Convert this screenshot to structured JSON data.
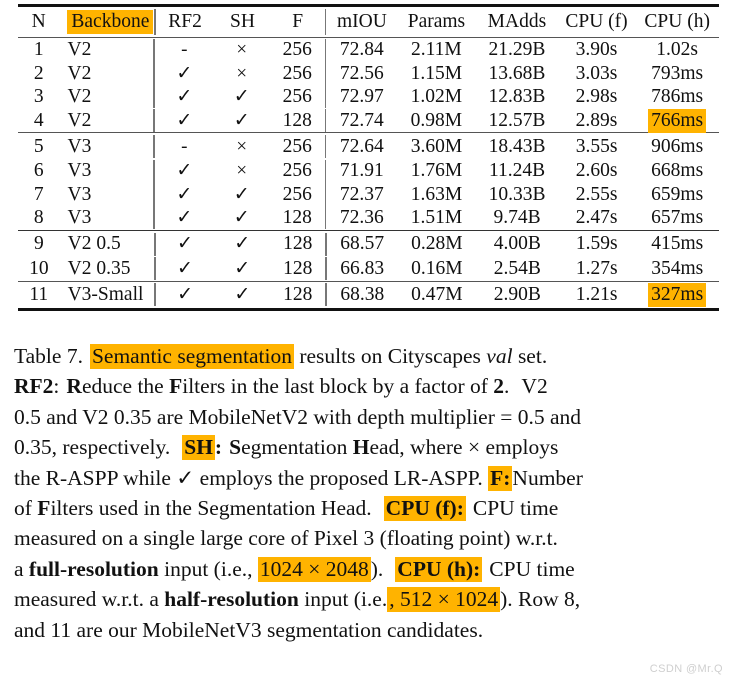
{
  "highlight_color": "#FFB300",
  "table": {
    "columns": [
      "N",
      "Backbone",
      "RF2",
      "SH",
      "F",
      "mIOU",
      "Params",
      "MAdds",
      "CPU (f)",
      "CPU (h)"
    ],
    "highlighted_columns": [
      "Backbone"
    ],
    "check_glyph": "✓",
    "cross_glyph": "×",
    "dash_glyph": "-",
    "rows": [
      {
        "n": "1",
        "backbone": "V2",
        "rf2": "-",
        "sh": "×",
        "f": "256",
        "miou": "72.84",
        "params": "2.11M",
        "madds": "21.29B",
        "cpu_f": "3.90s",
        "cpu_h": "1.02s",
        "cpu_h_highlight": false
      },
      {
        "n": "2",
        "backbone": "V2",
        "rf2": "✓",
        "sh": "×",
        "f": "256",
        "miou": "72.56",
        "params": "1.15M",
        "madds": "13.68B",
        "cpu_f": "3.03s",
        "cpu_h": "793ms",
        "cpu_h_highlight": false
      },
      {
        "n": "3",
        "backbone": "V2",
        "rf2": "✓",
        "sh": "✓",
        "f": "256",
        "miou": "72.97",
        "params": "1.02M",
        "madds": "12.83B",
        "cpu_f": "2.98s",
        "cpu_h": "786ms",
        "cpu_h_highlight": false
      },
      {
        "n": "4",
        "backbone": "V2",
        "rf2": "✓",
        "sh": "✓",
        "f": "128",
        "miou": "72.74",
        "params": "0.98M",
        "madds": "12.57B",
        "cpu_f": "2.89s",
        "cpu_h": "766ms",
        "cpu_h_highlight": true
      },
      {
        "n": "5",
        "backbone": "V3",
        "rf2": "-",
        "sh": "×",
        "f": "256",
        "miou": "72.64",
        "params": "3.60M",
        "madds": "18.43B",
        "cpu_f": "3.55s",
        "cpu_h": "906ms",
        "cpu_h_highlight": false
      },
      {
        "n": "6",
        "backbone": "V3",
        "rf2": "✓",
        "sh": "×",
        "f": "256",
        "miou": "71.91",
        "params": "1.76M",
        "madds": "11.24B",
        "cpu_f": "2.60s",
        "cpu_h": "668ms",
        "cpu_h_highlight": false
      },
      {
        "n": "7",
        "backbone": "V3",
        "rf2": "✓",
        "sh": "✓",
        "f": "256",
        "miou": "72.37",
        "params": "1.63M",
        "madds": "10.33B",
        "cpu_f": "2.55s",
        "cpu_h": "659ms",
        "cpu_h_highlight": false
      },
      {
        "n": "8",
        "backbone": "V3",
        "rf2": "✓",
        "sh": "✓",
        "f": "128",
        "miou": "72.36",
        "params": "1.51M",
        "madds": "9.74B",
        "cpu_f": "2.47s",
        "cpu_h": "657ms",
        "cpu_h_highlight": false
      },
      {
        "n": "9",
        "backbone": "V2 0.5",
        "rf2": "✓",
        "sh": "✓",
        "f": "128",
        "miou": "68.57",
        "params": "0.28M",
        "madds": "4.00B",
        "cpu_f": "1.59s",
        "cpu_h": "415ms",
        "cpu_h_highlight": false
      },
      {
        "n": "10",
        "backbone": "V2 0.35",
        "rf2": "✓",
        "sh": "✓",
        "f": "128",
        "miou": "66.83",
        "params": "0.16M",
        "madds": "2.54B",
        "cpu_f": "1.27s",
        "cpu_h": "354ms",
        "cpu_h_highlight": false
      },
      {
        "n": "11",
        "backbone": "V3-Small",
        "rf2": "✓",
        "sh": "✓",
        "f": "128",
        "miou": "68.38",
        "params": "0.47M",
        "madds": "2.90B",
        "cpu_f": "1.21s",
        "cpu_h": "327ms",
        "cpu_h_highlight": true
      }
    ]
  },
  "caption": {
    "label": "Table 7.",
    "hl_semantic": "Semantic segmentation",
    "l1_tail_a": "results on Cityscapes",
    "l1_italic": "val",
    "l1_tail_b": "set.",
    "l2_rf2": "RF2",
    "l2_colon": ":",
    "l2_r": "R",
    "l2_educe_the": "educe the",
    "l2_f": "F",
    "l2_ilters": "ilters in the last block by a factor of",
    "l2_two": "2",
    "l2_period": ".",
    "l2_v2": "V2",
    "l3": "0.5 and V2 0.35 are MobileNetV2 with depth multiplier = 0.5 and",
    "l4_a": "0.35, respectively.",
    "l4_sh": "SH",
    "l4_colon": ":",
    "l4_s": "S",
    "l4_egmentation": "egmentation",
    "l4_h": "H",
    "l4_ead_where": "ead, where",
    "l4_cross": "×",
    "l4_employs": "employs",
    "l5_a": "the R-ASPP while",
    "l5_check": "✓",
    "l5_b": "employs the proposed LR-ASPP.",
    "l5_f": "F:",
    "l5_c": "Number",
    "l6_of": "of",
    "l6_f": "F",
    "l6_ilters": "ilters used in the Segmentation Head.",
    "l6_cpuf": "CPU (f):",
    "l6_tail": "CPU time",
    "l7": "measured on a single large core of Pixel 3 (floating point) w.r.t.",
    "l8_a": "a",
    "l8_full": "full-resolution",
    "l8_b": "input (i.e.,",
    "l8_res": "1024 × 2048",
    "l8_c": ").",
    "l8_cpuh": "CPU (h):",
    "l8_d": "CPU time",
    "l9_a": "measured w.r.t. a",
    "l9_half": "half-resolution",
    "l9_b": "input (i.e.",
    "l9_res": ", 512 × 1024",
    "l9_c": "). Row 8,",
    "l10": "and 11 are our MobileNetV3 segmentation candidates."
  },
  "watermark": "CSDN @Mr.Q"
}
